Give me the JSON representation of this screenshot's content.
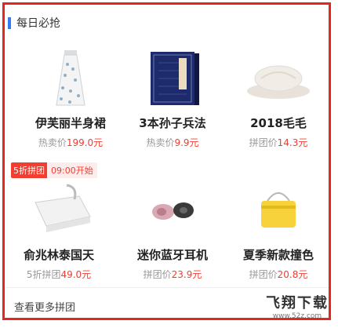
{
  "section": {
    "title": "每日必抢"
  },
  "products_row1": [
    {
      "name": "伊芙丽半身裙",
      "price_label": "热卖价",
      "price": "199.0元",
      "icon": "skirt-icon"
    },
    {
      "name": "3本孙子兵法",
      "price_label": "热卖价",
      "price": "9.9元",
      "icon": "book-box-icon"
    },
    {
      "name": "2018毛毛",
      "price_label": "拼团价",
      "price": "14.3元",
      "icon": "fur-slipper-icon"
    }
  ],
  "badge": {
    "discount": "5折拼团",
    "time": "09:00开始"
  },
  "products_row2": [
    {
      "name": "俞兆林泰国天",
      "price_label": "5折拼团",
      "price": "49.0元",
      "icon": "latex-pillow-icon"
    },
    {
      "name": "迷你蓝牙耳机",
      "price_label": "拼团价",
      "price": "23.9元",
      "icon": "bluetooth-earbud-icon"
    },
    {
      "name": "夏季新款撞色",
      "price_label": "拼团价",
      "price": "20.8元",
      "icon": "yellow-bag-icon"
    }
  ],
  "footer": {
    "more_label": "查看更多拼团"
  },
  "watermark": {
    "title": "飞翔下载",
    "url": "www.52z.com"
  },
  "colors": {
    "accent": "#f23d31",
    "frame": "#e5261f",
    "title_bar": "#2f7cf6"
  }
}
